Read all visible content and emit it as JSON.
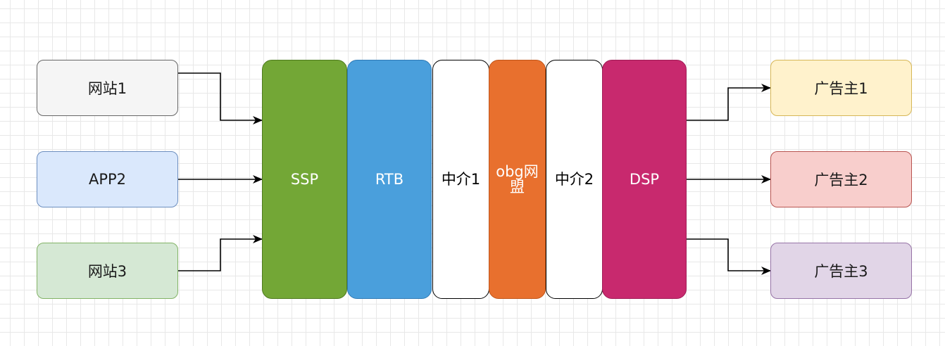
{
  "sources": [
    {
      "label": "网站1",
      "fill": "#f5f5f5",
      "stroke": "#666666"
    },
    {
      "label": "APP2",
      "fill": "#dae8fc",
      "stroke": "#6c8ebf"
    },
    {
      "label": "网站3",
      "fill": "#d5e8d4",
      "stroke": "#82b366"
    }
  ],
  "pillars": [
    {
      "label": "SSP",
      "fill": "#73a736",
      "stroke": "#4e7a1e",
      "text_color": "#ffffff"
    },
    {
      "label": "RTB",
      "fill": "#4a9fdc",
      "stroke": "#2f7ab5",
      "text_color": "#ffffff"
    },
    {
      "label": "中介1",
      "fill": "#ffffff",
      "stroke": "#000000",
      "text_color": "#000000"
    },
    {
      "label": "obg网盟",
      "fill": "#e8702e",
      "stroke": "#c0561a",
      "text_color": "#ffffff"
    },
    {
      "label": "中介2",
      "fill": "#ffffff",
      "stroke": "#000000",
      "text_color": "#000000"
    },
    {
      "label": "DSP",
      "fill": "#c8296e",
      "stroke": "#a01c56",
      "text_color": "#ffffff"
    }
  ],
  "advertisers": [
    {
      "label": "广告主1",
      "fill": "#fff2cc",
      "stroke": "#d6b656"
    },
    {
      "label": "广告主2",
      "fill": "#f8cecc",
      "stroke": "#b85450"
    },
    {
      "label": "广告主3",
      "fill": "#e1d5e7",
      "stroke": "#9673a6"
    }
  ],
  "edge_color": "#000000"
}
